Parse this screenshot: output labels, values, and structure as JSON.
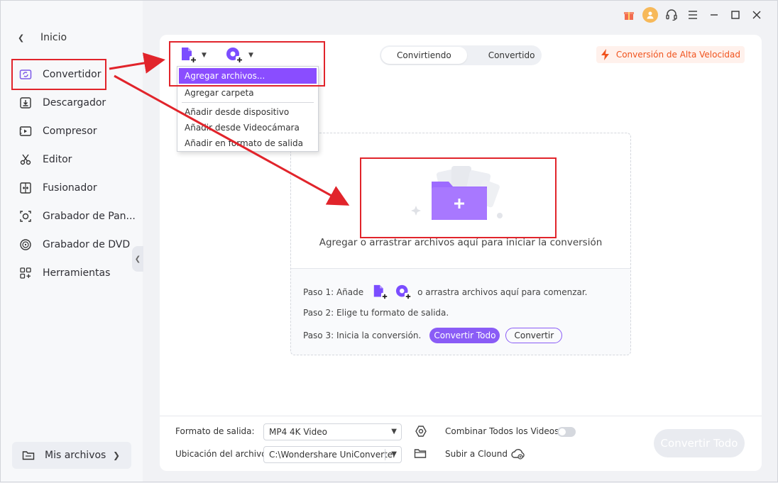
{
  "sidebar": {
    "back_label": "Inicio",
    "items": [
      {
        "label": "Convertidor",
        "icon": "converter-icon"
      },
      {
        "label": "Descargador",
        "icon": "download-icon"
      },
      {
        "label": "Compresor",
        "icon": "compress-icon"
      },
      {
        "label": "Editor",
        "icon": "scissors-icon"
      },
      {
        "label": "Fusionador",
        "icon": "merge-icon"
      },
      {
        "label": "Grabador de Pan...",
        "icon": "screen-record-icon"
      },
      {
        "label": "Grabador de DVD",
        "icon": "disc-icon"
      },
      {
        "label": "Herramientas",
        "icon": "tools-grid-icon"
      }
    ],
    "my_files_label": "Mis archivos"
  },
  "tabs": {
    "active": "Convirtiendo",
    "inactive": "Convertido"
  },
  "high_speed_label": "Conversión de Alta Velocidad",
  "dropdown": {
    "items": [
      "Agregar archivos...",
      "Agregar carpeta",
      "Añadir desde dispositivo",
      "Añadir desde Videocámara",
      "Añadir en formato de salida"
    ]
  },
  "dropzone": {
    "main_text": "Agregar o arrastrar archivos aquí para iniciar la conversión",
    "step1_prefix": "Paso 1: Añade",
    "step1_suffix": "o arrastra archivos aquí para comenzar.",
    "step2": "Paso 2: Elige tu formato de salida.",
    "step3": "Paso 3: Inicia la conversión.",
    "convert_all_button": "Convertir Todo",
    "convert_button": "Convertir"
  },
  "bottom": {
    "output_format_label": "Formato de salida:",
    "output_format_value": "MP4 4K Video",
    "file_location_label": "Ubicación del archivo:",
    "file_location_value": "C:\\Wondershare UniConverter",
    "merge_label": "Combinar Todos los Videos",
    "merge_enabled": false,
    "upload_label": "Subir a Clound",
    "convert_all_label": "Convertir Todo"
  },
  "colors": {
    "accent_purple": "#8a5cf6",
    "highlight_purple": "#8a4dff",
    "speed_orange": "#f0531d",
    "annotation_red": "#e1242b"
  }
}
